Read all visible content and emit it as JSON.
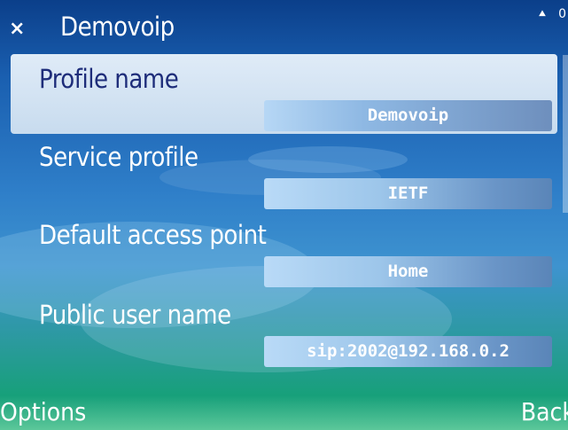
{
  "titlebar": {
    "close_glyph": "×",
    "title": "Demovoip",
    "status_up_icon": "upload-arrow-icon",
    "status_text": "0"
  },
  "settings": [
    {
      "label": "Profile name",
      "value": "Demovoip",
      "selected": true
    },
    {
      "label": "Service profile",
      "value": "IETF",
      "selected": false
    },
    {
      "label": "Default access point",
      "value": "Home",
      "selected": false
    },
    {
      "label": "Public user name",
      "value": "sip:2002@192.168.0.2",
      "selected": false
    }
  ],
  "softkeys": {
    "left": "Options",
    "right": "Back"
  },
  "colors": {
    "selected_label": "#1e2d7a",
    "accent": "#1a5fb0"
  }
}
